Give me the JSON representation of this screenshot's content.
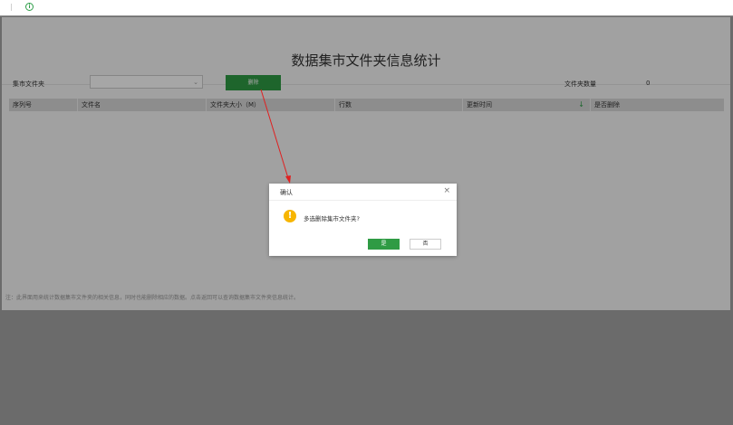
{
  "title": "数据集市文件夹信息统计",
  "filters": {
    "folder_label": "集市文件夹",
    "select_value": "",
    "delete_label": "删除",
    "count_label": "文件夹数量",
    "count_value": "0"
  },
  "table": {
    "headers": [
      "序列号",
      "文件名",
      "文件夹大小（M）",
      "行数",
      "更新时间",
      "是否删除"
    ],
    "sort_icon": "↓"
  },
  "note": "注：此界面用来统计数据集市文件夹的相关信息，同时也能删除相应的数据。点击返回可以查询数据集市文件夹信息统计。",
  "dialog": {
    "title": "确认",
    "message": "多选删除集市文件夹?",
    "yes_label": "是",
    "no_label": "否",
    "close": "×"
  },
  "icons": {
    "info": "i",
    "warn": "!"
  },
  "colors": {
    "accent": "#2f9b44",
    "warning": "#f7b500",
    "annotation_arrow": "#e02020"
  }
}
